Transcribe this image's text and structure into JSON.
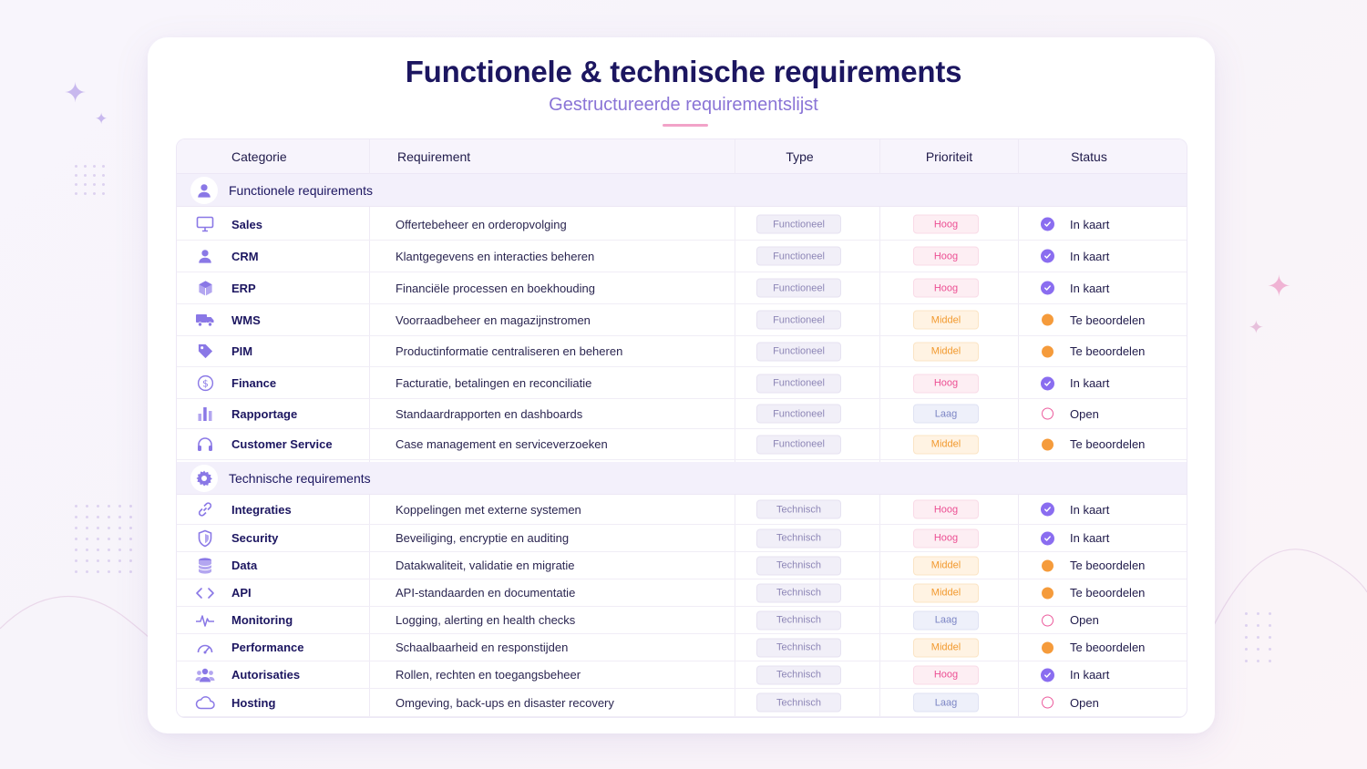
{
  "header": {
    "title": "Functionele & technische requirements",
    "subtitle": "Gestructureerde requirementslijst"
  },
  "columns": [
    "Categorie",
    "Requirement",
    "Type",
    "Prioriteit",
    "Status"
  ],
  "colors": {
    "accent": "#8a6df0",
    "title": "#1c1660",
    "subtitle": "#8a74d6",
    "hoog": "#ec4f93",
    "middel": "#f2992e",
    "laag": "#7b84c4"
  },
  "sections": [
    {
      "label": "Functionele requirements",
      "icon": "user-icon",
      "rows": [
        {
          "icon": "monitor-icon",
          "category": "Sales",
          "requirement": "Offertebeheer en orderopvolging",
          "type": "Functioneel",
          "priority": "Hoog",
          "status": "In kaart",
          "status_kind": "check"
        },
        {
          "icon": "user-icon",
          "category": "CRM",
          "requirement": "Klantgegevens en interacties beheren",
          "type": "Functioneel",
          "priority": "Hoog",
          "status": "In kaart",
          "status_kind": "check"
        },
        {
          "icon": "cube-icon",
          "category": "ERP",
          "requirement": "Financiële processen en boekhouding",
          "type": "Functioneel",
          "priority": "Hoog",
          "status": "In kaart",
          "status_kind": "check"
        },
        {
          "icon": "truck-icon",
          "category": "WMS",
          "requirement": "Voorraadbeheer en magazijnstromen",
          "type": "Functioneel",
          "priority": "Middel",
          "status": "Te beoordelen",
          "status_kind": "orange"
        },
        {
          "icon": "tag-icon",
          "category": "PIM",
          "requirement": "Productinformatie centraliseren en beheren",
          "type": "Functioneel",
          "priority": "Middel",
          "status": "Te beoordelen",
          "status_kind": "orange"
        },
        {
          "icon": "dollar-icon",
          "category": "Finance",
          "requirement": "Facturatie, betalingen en reconciliatie",
          "type": "Functioneel",
          "priority": "Hoog",
          "status": "In kaart",
          "status_kind": "check"
        },
        {
          "icon": "bar-chart-icon",
          "category": "Rapportage",
          "requirement": "Standaardrapporten en dashboards",
          "type": "Functioneel",
          "priority": "Laag",
          "status": "Open",
          "status_kind": "open"
        },
        {
          "icon": "headset-icon",
          "category": "Customer Service",
          "requirement": "Case management en serviceverzoeken",
          "type": "Functioneel",
          "priority": "Middel",
          "status": "Te beoordelen",
          "status_kind": "orange"
        }
      ]
    },
    {
      "label": "Technische requirements",
      "icon": "gear-icon",
      "rows": [
        {
          "icon": "link-icon",
          "category": "Integraties",
          "requirement": "Koppelingen met externe systemen",
          "type": "Technisch",
          "priority": "Hoog",
          "status": "In kaart",
          "status_kind": "check"
        },
        {
          "icon": "shield-icon",
          "category": "Security",
          "requirement": "Beveiliging, encryptie en auditing",
          "type": "Technisch",
          "priority": "Hoog",
          "status": "In kaart",
          "status_kind": "check"
        },
        {
          "icon": "database-icon",
          "category": "Data",
          "requirement": "Datakwaliteit, validatie en migratie",
          "type": "Technisch",
          "priority": "Middel",
          "status": "Te beoordelen",
          "status_kind": "orange"
        },
        {
          "icon": "code-icon",
          "category": "API",
          "requirement": "API-standaarden en documentatie",
          "type": "Technisch",
          "priority": "Middel",
          "status": "Te beoordelen",
          "status_kind": "orange"
        },
        {
          "icon": "pulse-icon",
          "category": "Monitoring",
          "requirement": "Logging, alerting en health checks",
          "type": "Technisch",
          "priority": "Laag",
          "status": "Open",
          "status_kind": "open"
        },
        {
          "icon": "gauge-icon",
          "category": "Performance",
          "requirement": "Schaalbaarheid en responstijden",
          "type": "Technisch",
          "priority": "Middel",
          "status": "Te beoordelen",
          "status_kind": "orange"
        },
        {
          "icon": "users-icon",
          "category": "Autorisaties",
          "requirement": "Rollen, rechten en toegangsbeheer",
          "type": "Technisch",
          "priority": "Hoog",
          "status": "In kaart",
          "status_kind": "check"
        },
        {
          "icon": "cloud-icon",
          "category": "Hosting",
          "requirement": "Omgeving, back-ups en disaster recovery",
          "type": "Technisch",
          "priority": "Laag",
          "status": "Open",
          "status_kind": "open"
        }
      ]
    }
  ]
}
